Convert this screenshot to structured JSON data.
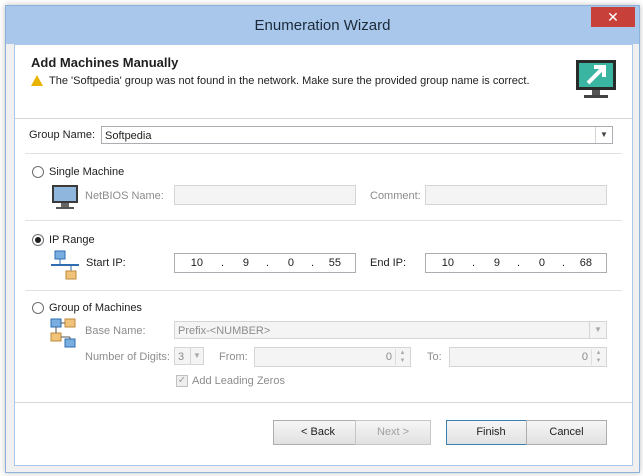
{
  "window": {
    "title": "Enumeration Wizard",
    "close_glyph": "✕"
  },
  "header": {
    "title": "Add Machines Manually",
    "warning": "The 'Softpedia' group was not found in the network. Make sure the provided group name is correct."
  },
  "group_name": {
    "label": "Group Name:",
    "value": "Softpedia"
  },
  "single_machine": {
    "label": "Single Machine",
    "netbios_label": "NetBIOS Name:",
    "netbios_value": "",
    "comment_label": "Comment:",
    "comment_value": ""
  },
  "ip_range": {
    "label": "IP Range",
    "start_label": "Start IP:",
    "start_ip": [
      "10",
      "9",
      "0",
      "55"
    ],
    "end_label": "End IP:",
    "end_ip": [
      "10",
      "9",
      "0",
      "68"
    ]
  },
  "group_of_machines": {
    "label": "Group of Machines",
    "base_name_label": "Base Name:",
    "base_name_value": "Prefix-<NUMBER>",
    "digits_label": "Number of Digits:",
    "digits_value": "3",
    "from_label": "From:",
    "from_value": "0",
    "to_label": "To:",
    "to_value": "0",
    "leading_zeros_label": "Add Leading Zeros"
  },
  "buttons": {
    "back": "< Back",
    "next": "Next >",
    "finish": "Finish",
    "cancel": "Cancel"
  },
  "colors": {
    "titlebar": "#a9c7ea",
    "close": "#c7403a",
    "warning": "#e8b400",
    "accent": "#3c7fb1"
  }
}
